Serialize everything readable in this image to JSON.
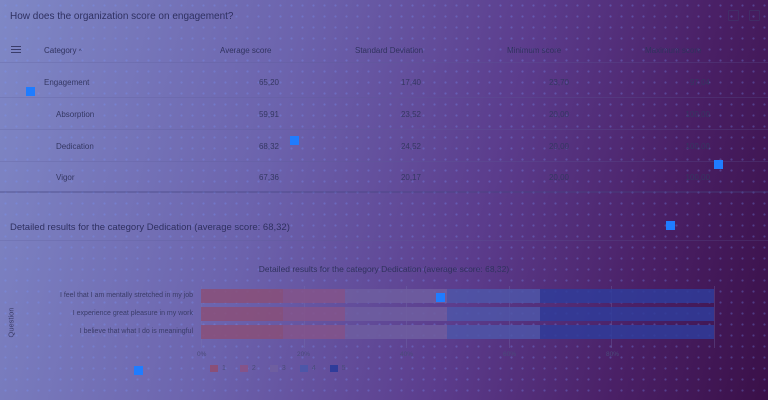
{
  "panel1": {
    "title": "How does the organization score on engagement?",
    "columns": [
      "Category",
      "Average score",
      "Standard Deviation",
      "Minimum score",
      "Maximum score"
    ],
    "sort_indicator": "^",
    "rows": [
      {
        "category": "Engagement",
        "avg": "65,20",
        "sd": "17,40",
        "min": "23,70",
        "max": "97,04"
      },
      {
        "category": "Absorption",
        "avg": "59,91",
        "sd": "23,52",
        "min": "20,00",
        "max": "100,00"
      },
      {
        "category": "Dedication",
        "avg": "68,32",
        "sd": "24,52",
        "min": "20,00",
        "max": "100,00"
      },
      {
        "category": "Vigor",
        "avg": "67,36",
        "sd": "20,17",
        "min": "20,00",
        "max": "100,00"
      }
    ]
  },
  "panel2": {
    "title": "Detailed results for the category Dedication (average score: 68,32)"
  },
  "chart_data": {
    "type": "bar",
    "orientation": "horizontal",
    "stacked": true,
    "title": "Detailed results for the category Dedication (average score: 68,32)",
    "ylabel": "Question",
    "categories": [
      "I feel that I am mentally stretched in my job",
      "I experience great pleasure in my work",
      "I believe that what I do is meaningful"
    ],
    "x_ticks": [
      "0%",
      "20%",
      "40%",
      "60%",
      "80%"
    ],
    "xlim": [
      0,
      100
    ],
    "series": [
      {
        "name": "1",
        "color": "#8a4f78",
        "values": [
          16,
          16,
          16
        ]
      },
      {
        "name": "2",
        "color": "#84538a",
        "values": [
          12,
          12,
          12
        ]
      },
      {
        "name": "3",
        "color": "#6e5ea0",
        "values": [
          20,
          20,
          20
        ]
      },
      {
        "name": "4",
        "color": "#4d56a8",
        "values": [
          18,
          18,
          18
        ]
      },
      {
        "name": "5",
        "color": "#2f3c9a",
        "values": [
          34,
          34,
          34
        ]
      }
    ],
    "legend_position": "bottom"
  }
}
